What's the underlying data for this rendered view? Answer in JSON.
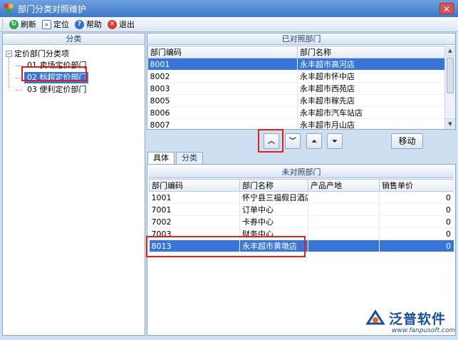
{
  "window": {
    "title": "部门分类对照维护"
  },
  "toolbar": {
    "refresh": "刷新",
    "locate": "定位",
    "help": "帮助",
    "exit": "退出"
  },
  "left_panel": {
    "header": "分类",
    "root": "定价部门分类项",
    "items": [
      "01 卖场定价部门",
      "02 标超定价部门",
      "03 便利定价部门"
    ]
  },
  "top_panel": {
    "header": "已对照部门",
    "columns": [
      "部门编码",
      "部门名称"
    ],
    "rows": [
      [
        "8001",
        "永丰超市高河店"
      ],
      [
        "8002",
        "永丰超市怀中店"
      ],
      [
        "8003",
        "永丰超市西苑店"
      ],
      [
        "8005",
        "永丰超市稼先店"
      ],
      [
        "8006",
        "永丰超市汽车站店"
      ],
      [
        "8007",
        "永丰超市月山店"
      ]
    ]
  },
  "controls": {
    "move_label": "移动"
  },
  "tabs": [
    "具体",
    "分类"
  ],
  "bottom_panel": {
    "header": "未对照部门",
    "columns": [
      "部门编码",
      "部门名称",
      "产品产地",
      "销售单价"
    ],
    "rows": [
      [
        "1001",
        "怀宁县三福假日酒店",
        "",
        "0"
      ],
      [
        "7001",
        "订单中心",
        "",
        "0"
      ],
      [
        "7002",
        "卡券中心",
        "",
        "0"
      ],
      [
        "7003",
        "财务中心",
        "",
        "0"
      ],
      [
        "8013",
        "永丰超市黄墩店",
        "",
        "0"
      ]
    ]
  },
  "logo": {
    "name": "泛普软件",
    "url": "www.fanpusoft.com"
  },
  "colors": {
    "selection": "#3875d7",
    "highlight_box": "#e02020",
    "titlebar": "#3f78c8"
  }
}
